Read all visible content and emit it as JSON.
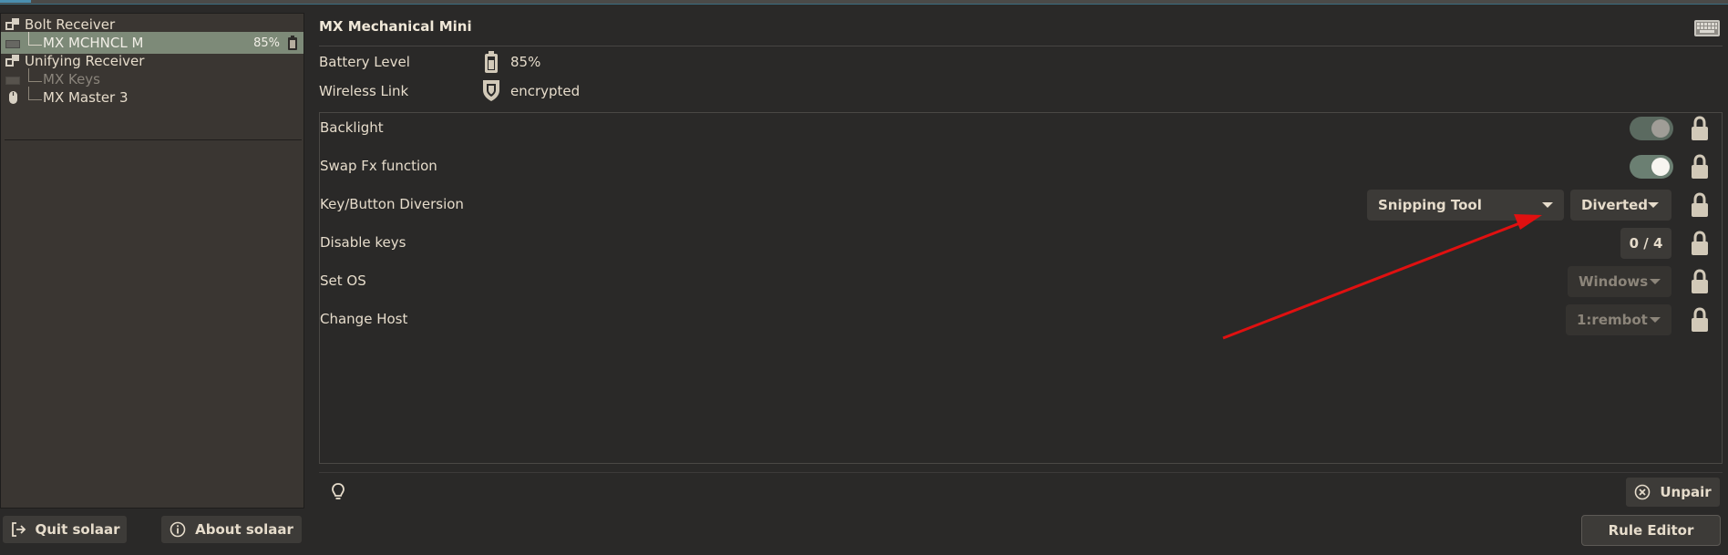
{
  "sidebar": {
    "items": [
      {
        "label": "Bolt Receiver",
        "icon": "receiver-icon",
        "level": 0
      },
      {
        "label": "MX MCHNCL M",
        "icon": "keyboard-icon",
        "level": 1,
        "battery": "85%",
        "selected": true
      },
      {
        "label": "Unifying Receiver",
        "icon": "receiver-icon",
        "level": 0
      },
      {
        "label": "MX Keys",
        "icon": "keyboard-icon",
        "level": 1,
        "disabled": true
      },
      {
        "label": "MX Master 3",
        "icon": "mouse-icon",
        "level": 1
      }
    ],
    "quit_label": "Quit solaar",
    "about_label": "About solaar"
  },
  "device": {
    "title": "MX Mechanical Mini",
    "battery_label": "Battery Level",
    "battery_value": "85%",
    "link_label": "Wireless Link",
    "link_value": "encrypted"
  },
  "settings": {
    "backlight": {
      "label": "Backlight",
      "on": false
    },
    "swap_fx": {
      "label": "Swap Fx function",
      "on": true
    },
    "diversion": {
      "label": "Key/Button Diversion",
      "key": "Snipping Tool",
      "mode": "Diverted"
    },
    "disable_keys": {
      "label": "Disable keys",
      "value": "0 / 4"
    },
    "set_os": {
      "label": "Set OS",
      "value": "Windows"
    },
    "change_host": {
      "label": "Change Host",
      "value": "1:rembot"
    }
  },
  "footer": {
    "unpair_label": "Unpair",
    "rule_editor_label": "Rule Editor"
  },
  "colors": {
    "background": "#2a2928",
    "selected_row": "#7d8a78",
    "accent_arrow": "#e01010",
    "toggle_on": "#6b7f72"
  }
}
